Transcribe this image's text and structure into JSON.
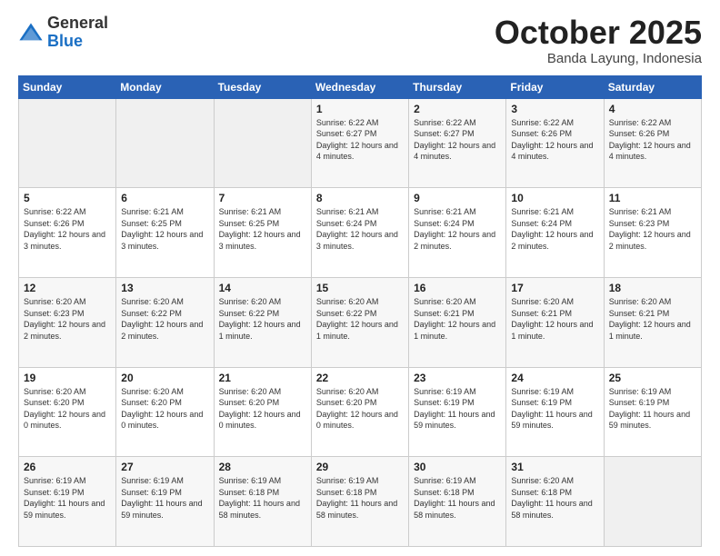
{
  "header": {
    "logo_general": "General",
    "logo_blue": "Blue",
    "title": "October 2025",
    "location": "Banda Layung, Indonesia"
  },
  "weekdays": [
    "Sunday",
    "Monday",
    "Tuesday",
    "Wednesday",
    "Thursday",
    "Friday",
    "Saturday"
  ],
  "weeks": [
    [
      {
        "day": "",
        "info": ""
      },
      {
        "day": "",
        "info": ""
      },
      {
        "day": "",
        "info": ""
      },
      {
        "day": "1",
        "info": "Sunrise: 6:22 AM\nSunset: 6:27 PM\nDaylight: 12 hours\nand 4 minutes."
      },
      {
        "day": "2",
        "info": "Sunrise: 6:22 AM\nSunset: 6:27 PM\nDaylight: 12 hours\nand 4 minutes."
      },
      {
        "day": "3",
        "info": "Sunrise: 6:22 AM\nSunset: 6:26 PM\nDaylight: 12 hours\nand 4 minutes."
      },
      {
        "day": "4",
        "info": "Sunrise: 6:22 AM\nSunset: 6:26 PM\nDaylight: 12 hours\nand 4 minutes."
      }
    ],
    [
      {
        "day": "5",
        "info": "Sunrise: 6:22 AM\nSunset: 6:26 PM\nDaylight: 12 hours\nand 3 minutes."
      },
      {
        "day": "6",
        "info": "Sunrise: 6:21 AM\nSunset: 6:25 PM\nDaylight: 12 hours\nand 3 minutes."
      },
      {
        "day": "7",
        "info": "Sunrise: 6:21 AM\nSunset: 6:25 PM\nDaylight: 12 hours\nand 3 minutes."
      },
      {
        "day": "8",
        "info": "Sunrise: 6:21 AM\nSunset: 6:24 PM\nDaylight: 12 hours\nand 3 minutes."
      },
      {
        "day": "9",
        "info": "Sunrise: 6:21 AM\nSunset: 6:24 PM\nDaylight: 12 hours\nand 2 minutes."
      },
      {
        "day": "10",
        "info": "Sunrise: 6:21 AM\nSunset: 6:24 PM\nDaylight: 12 hours\nand 2 minutes."
      },
      {
        "day": "11",
        "info": "Sunrise: 6:21 AM\nSunset: 6:23 PM\nDaylight: 12 hours\nand 2 minutes."
      }
    ],
    [
      {
        "day": "12",
        "info": "Sunrise: 6:20 AM\nSunset: 6:23 PM\nDaylight: 12 hours\nand 2 minutes."
      },
      {
        "day": "13",
        "info": "Sunrise: 6:20 AM\nSunset: 6:22 PM\nDaylight: 12 hours\nand 2 minutes."
      },
      {
        "day": "14",
        "info": "Sunrise: 6:20 AM\nSunset: 6:22 PM\nDaylight: 12 hours\nand 1 minute."
      },
      {
        "day": "15",
        "info": "Sunrise: 6:20 AM\nSunset: 6:22 PM\nDaylight: 12 hours\nand 1 minute."
      },
      {
        "day": "16",
        "info": "Sunrise: 6:20 AM\nSunset: 6:21 PM\nDaylight: 12 hours\nand 1 minute."
      },
      {
        "day": "17",
        "info": "Sunrise: 6:20 AM\nSunset: 6:21 PM\nDaylight: 12 hours\nand 1 minute."
      },
      {
        "day": "18",
        "info": "Sunrise: 6:20 AM\nSunset: 6:21 PM\nDaylight: 12 hours\nand 1 minute."
      }
    ],
    [
      {
        "day": "19",
        "info": "Sunrise: 6:20 AM\nSunset: 6:20 PM\nDaylight: 12 hours\nand 0 minutes."
      },
      {
        "day": "20",
        "info": "Sunrise: 6:20 AM\nSunset: 6:20 PM\nDaylight: 12 hours\nand 0 minutes."
      },
      {
        "day": "21",
        "info": "Sunrise: 6:20 AM\nSunset: 6:20 PM\nDaylight: 12 hours\nand 0 minutes."
      },
      {
        "day": "22",
        "info": "Sunrise: 6:20 AM\nSunset: 6:20 PM\nDaylight: 12 hours\nand 0 minutes."
      },
      {
        "day": "23",
        "info": "Sunrise: 6:19 AM\nSunset: 6:19 PM\nDaylight: 11 hours\nand 59 minutes."
      },
      {
        "day": "24",
        "info": "Sunrise: 6:19 AM\nSunset: 6:19 PM\nDaylight: 11 hours\nand 59 minutes."
      },
      {
        "day": "25",
        "info": "Sunrise: 6:19 AM\nSunset: 6:19 PM\nDaylight: 11 hours\nand 59 minutes."
      }
    ],
    [
      {
        "day": "26",
        "info": "Sunrise: 6:19 AM\nSunset: 6:19 PM\nDaylight: 11 hours\nand 59 minutes."
      },
      {
        "day": "27",
        "info": "Sunrise: 6:19 AM\nSunset: 6:19 PM\nDaylight: 11 hours\nand 59 minutes."
      },
      {
        "day": "28",
        "info": "Sunrise: 6:19 AM\nSunset: 6:18 PM\nDaylight: 11 hours\nand 58 minutes."
      },
      {
        "day": "29",
        "info": "Sunrise: 6:19 AM\nSunset: 6:18 PM\nDaylight: 11 hours\nand 58 minutes."
      },
      {
        "day": "30",
        "info": "Sunrise: 6:19 AM\nSunset: 6:18 PM\nDaylight: 11 hours\nand 58 minutes."
      },
      {
        "day": "31",
        "info": "Sunrise: 6:20 AM\nSunset: 6:18 PM\nDaylight: 11 hours\nand 58 minutes."
      },
      {
        "day": "",
        "info": ""
      }
    ]
  ]
}
